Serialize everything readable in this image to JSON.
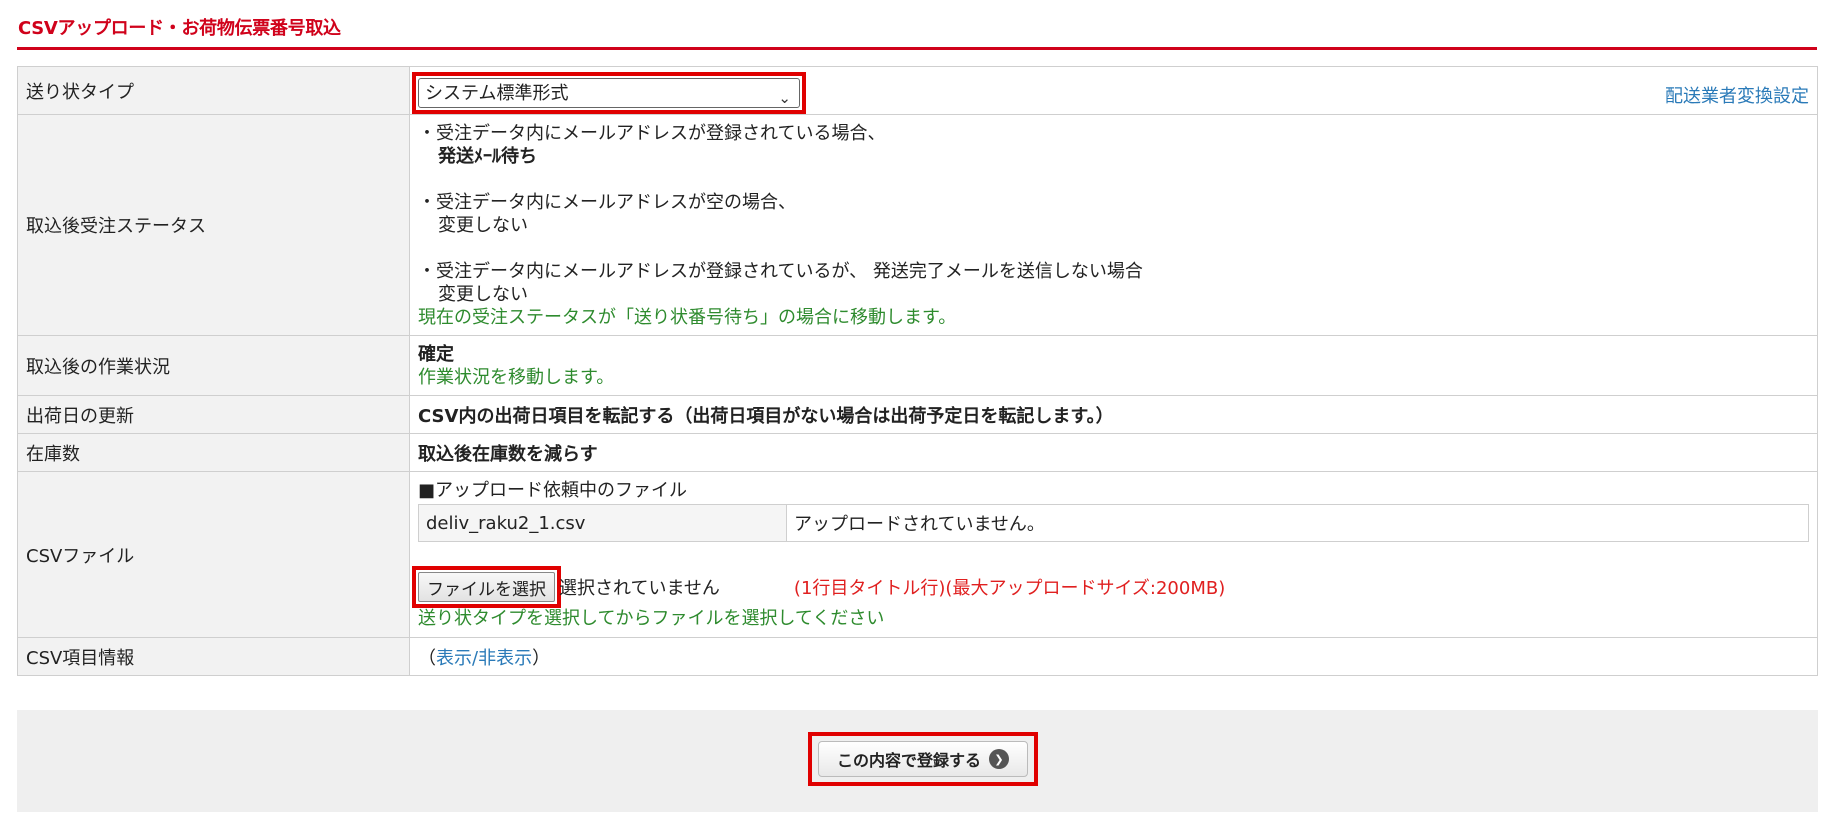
{
  "header": {
    "title": "CSVアップロード・お荷物伝票番号取込"
  },
  "form": {
    "invoice_type": {
      "label": "送り状タイプ",
      "selected": "システム標準形式",
      "carrier_link": "配送業者変換設定"
    },
    "post_import_status": {
      "label": "取込後受注ステータス",
      "bullet1_line1": "・受注データ内にメールアドレスが登録されている場合、",
      "bullet1_line2": "発送ﾒｰﾙ待ち",
      "bullet2_line1": "・受注データ内にメールアドレスが空の場合、",
      "bullet2_line2": "変更しない",
      "bullet3_line1": "・受注データ内にメールアドレスが登録されているが、 発送完了メールを送信しない場合",
      "bullet3_line2": "変更しない",
      "note": "現在の受注ステータスが「送り状番号待ち」の場合に移動します。"
    },
    "work_status": {
      "label": "取込後の作業状況",
      "value": "確定",
      "note": "作業状況を移動します。"
    },
    "ship_date": {
      "label": "出荷日の更新",
      "value": "CSV内の出荷日項目を転記する（出荷日項目がない場合は出荷予定日を転記します。）"
    },
    "stock": {
      "label": "在庫数",
      "value": "取込後在庫数を減らす"
    },
    "csv_file": {
      "label": "CSVファイル",
      "pending_heading": "■アップロード依頼中のファイル",
      "file_name": "deliv_raku2_1.csv",
      "file_status": "アップロードされていません。",
      "choose_button": "ファイルを選択",
      "no_file": "選択されていません",
      "size_note": "(1行目タイトル行)(最大アップロードサイズ:200MB)",
      "hint": "送り状タイプを選択してからファイルを選択してください"
    },
    "csv_info": {
      "label": "CSV項目情報",
      "open_paren": "（",
      "toggle_link": "表示/非表示",
      "close_paren": "）"
    }
  },
  "footer": {
    "submit_label": "この内容で登録する",
    "submit_icon": "chevron-right-circle-icon"
  }
}
